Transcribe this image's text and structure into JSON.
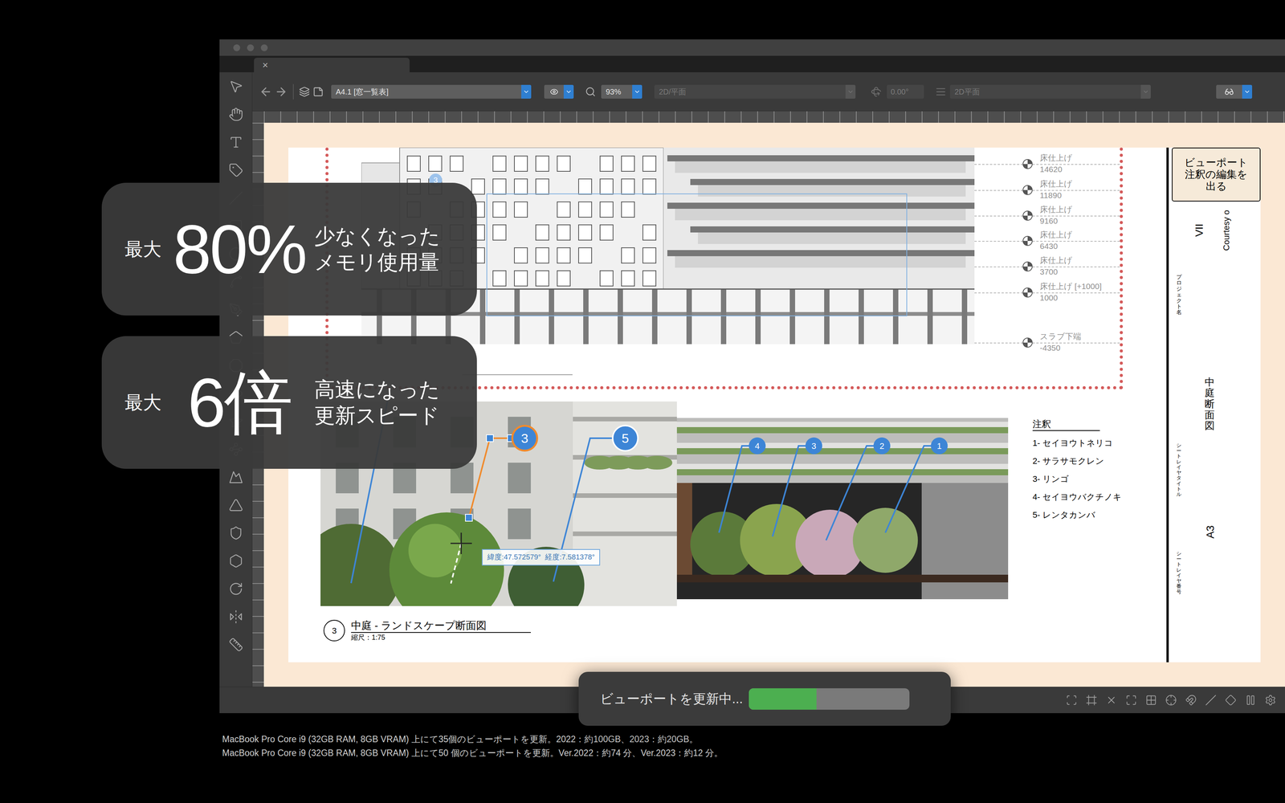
{
  "window": {
    "tab": {
      "close": "×"
    }
  },
  "toolbar": {
    "sheet_layer": "A4.1 [窓一覧表]",
    "zoom": "93%",
    "view": {
      "text": "2D/平面",
      "disabled": true
    },
    "angle": {
      "text": "0.00°",
      "disabled": true
    },
    "projection": {
      "text": "2D平面",
      "disabled": true
    }
  },
  "elevation": {
    "callout": "3",
    "levels": [
      {
        "label": "床仕上げ",
        "value": "14620"
      },
      {
        "label": "床仕上げ",
        "value": "11890"
      },
      {
        "label": "床仕上げ",
        "value": "9160"
      },
      {
        "label": "床仕上げ",
        "value": "6430"
      },
      {
        "label": "床仕上げ",
        "value": "3700"
      },
      {
        "label": "床仕上げ [+1000]",
        "value": "1000"
      },
      {
        "label": "スラブ下端",
        "value": "-4350"
      }
    ]
  },
  "section": {
    "callouts": [
      {
        "number": "3",
        "selected": true
      },
      {
        "number": "5",
        "selected": false
      }
    ],
    "coordinates": "緯度:47.572579°  経度:7.581378°",
    "title": {
      "number": "3",
      "name": "中庭 - ランドスケープ断面図",
      "scale": "縮尺：1:75"
    }
  },
  "landscape": {
    "callouts": [
      {
        "number": "4"
      },
      {
        "number": "3"
      },
      {
        "number": "2"
      },
      {
        "number": "1"
      }
    ]
  },
  "notes": {
    "title": "注釈",
    "items": [
      "1- セイヨウトネリコ",
      "2- サラサモクレン",
      "3- リンゴ",
      "4- セイヨウバクチノキ",
      "5- レンタカンバ"
    ]
  },
  "title_block": {
    "exit_button": [
      "ビューポート",
      "注釈の編集を",
      "出る"
    ],
    "project_code": "VII",
    "credit": "Courtesy o",
    "project_label": "プロジェクト名",
    "sheet_title": "中庭 断面図",
    "sheet_title_label": "シートレイヤタイトル",
    "sheet_number": "A3",
    "sheet_number_label": "シートレイヤ番号"
  },
  "stats": [
    {
      "prefix": "最大",
      "value": "80%",
      "caption": [
        "少なくなった",
        "メモリ使用量"
      ]
    },
    {
      "prefix": "最大",
      "value": "6倍",
      "caption": [
        "高速になった",
        "更新スピード"
      ]
    }
  ],
  "progress": {
    "label": "ビューポートを更新中...",
    "level": 0.42
  },
  "footnotes": [
    "MacBook Pro Core i9 (32GB RAM, 8GB VRAM) 上にて35個のビューポートを更新。2022：約100GB、2023：約20GB。",
    "MacBook Pro Core i9 (32GB RAM, 8GB VRAM) 上にて50 個のビューポートを更新。Ver.2022：約74 分、Ver.2023：約12 分。"
  ]
}
